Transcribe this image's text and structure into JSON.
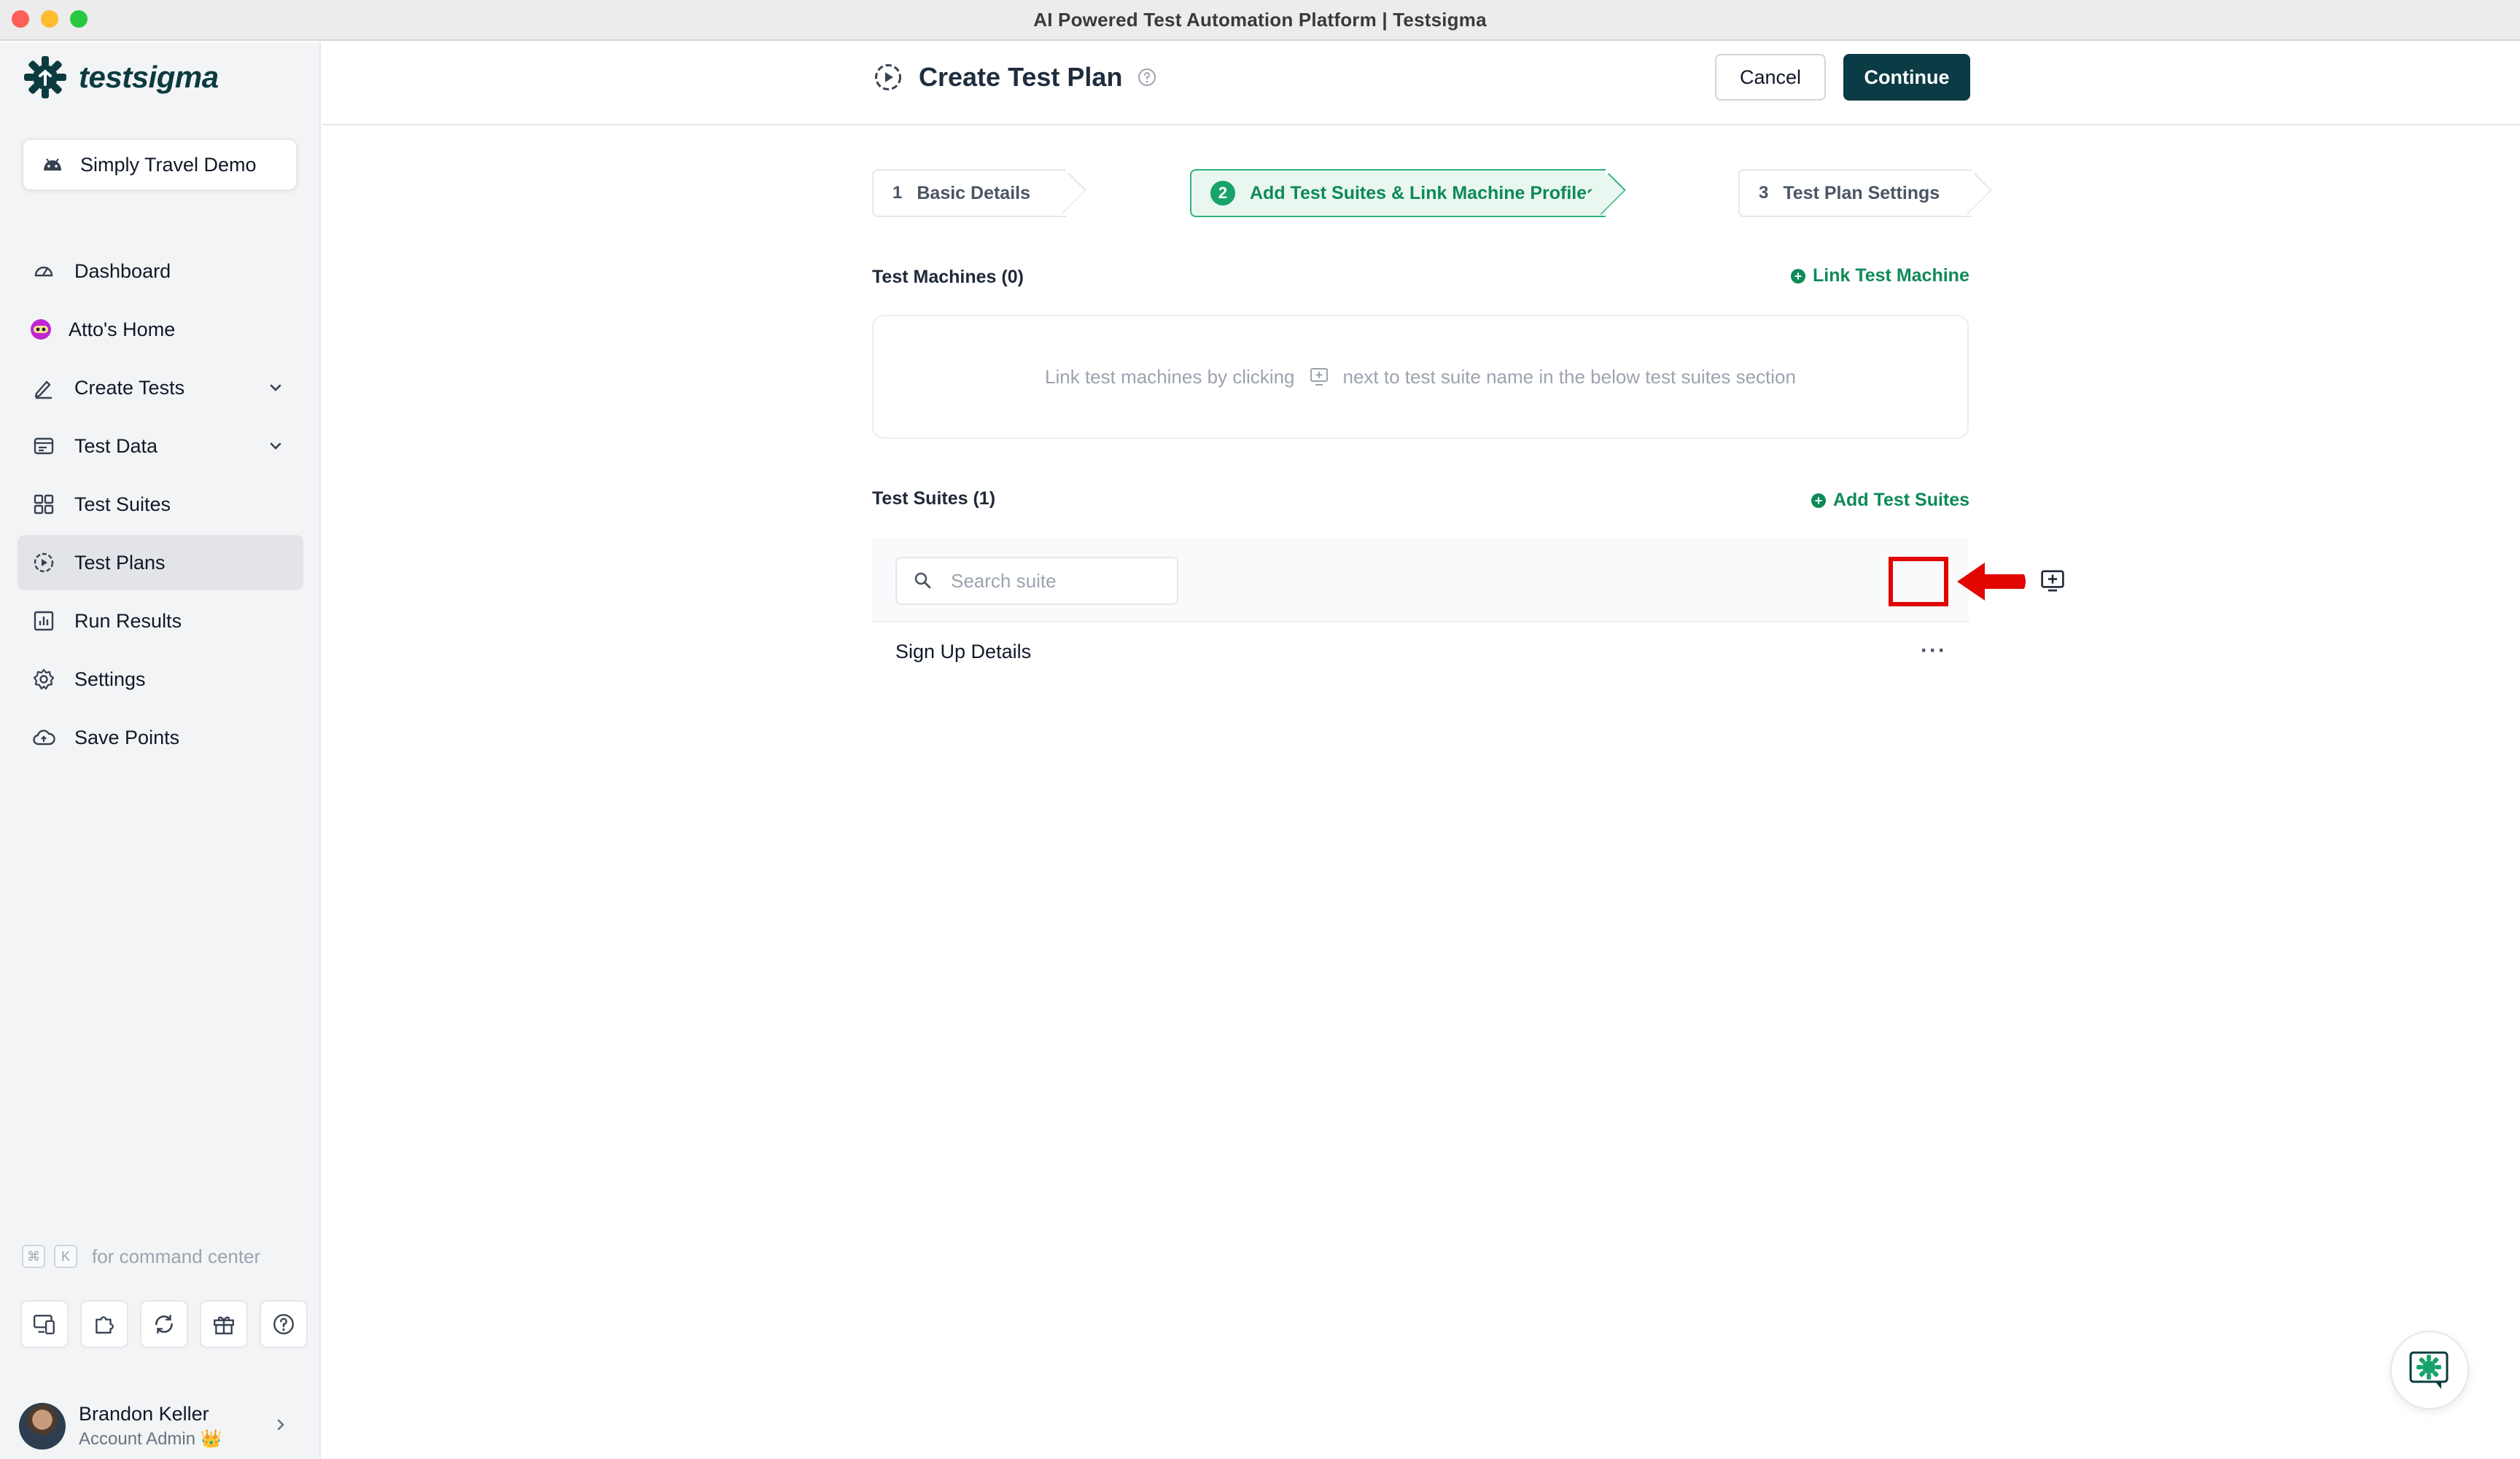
{
  "window": {
    "title": "AI Powered Test Automation Platform | Testsigma"
  },
  "brand": {
    "name": "testsigma",
    "color": "#0b3b3f",
    "accent": "#0e8a57"
  },
  "project": {
    "name": "Simply Travel Demo"
  },
  "sidebar": {
    "items": [
      {
        "label": "Dashboard",
        "icon": "dashboard-icon"
      },
      {
        "label": "Atto's Home",
        "icon": "atto-icon"
      },
      {
        "label": "Create Tests",
        "icon": "pencil-icon",
        "expandable": true
      },
      {
        "label": "Test Data",
        "icon": "test-data-icon",
        "expandable": true
      },
      {
        "label": "Test Suites",
        "icon": "grid-icon"
      },
      {
        "label": "Test Plans",
        "icon": "play-circle-icon",
        "active": true
      },
      {
        "label": "Run Results",
        "icon": "chart-icon"
      },
      {
        "label": "Settings",
        "icon": "gear-icon"
      },
      {
        "label": "Save Points",
        "icon": "cloud-icon"
      }
    ],
    "command_hint": {
      "key1": "⌘",
      "key2": "K",
      "text": "for command center"
    },
    "user": {
      "name": "Brandon Keller",
      "role": "Account Admin",
      "badge": "👑"
    }
  },
  "header": {
    "title": "Create Test Plan",
    "cancel_label": "Cancel",
    "continue_label": "Continue"
  },
  "steps": [
    {
      "number": "1",
      "label": "Basic Details",
      "active": false
    },
    {
      "number": "2",
      "label": "Add Test Suites & Link Machine Profiles",
      "active": true
    },
    {
      "number": "3",
      "label": "Test Plan Settings",
      "active": false
    }
  ],
  "test_machines": {
    "title": "Test Machines (0)",
    "link_label": "Link Test Machine",
    "empty_before": "Link test machines by clicking",
    "empty_after": "next to test suite name in the below test suites section"
  },
  "test_suites": {
    "title": "Test Suites (1)",
    "add_label": "Add Test Suites",
    "search_placeholder": "Search suite",
    "rows": [
      {
        "name": "Sign Up Details"
      }
    ]
  }
}
